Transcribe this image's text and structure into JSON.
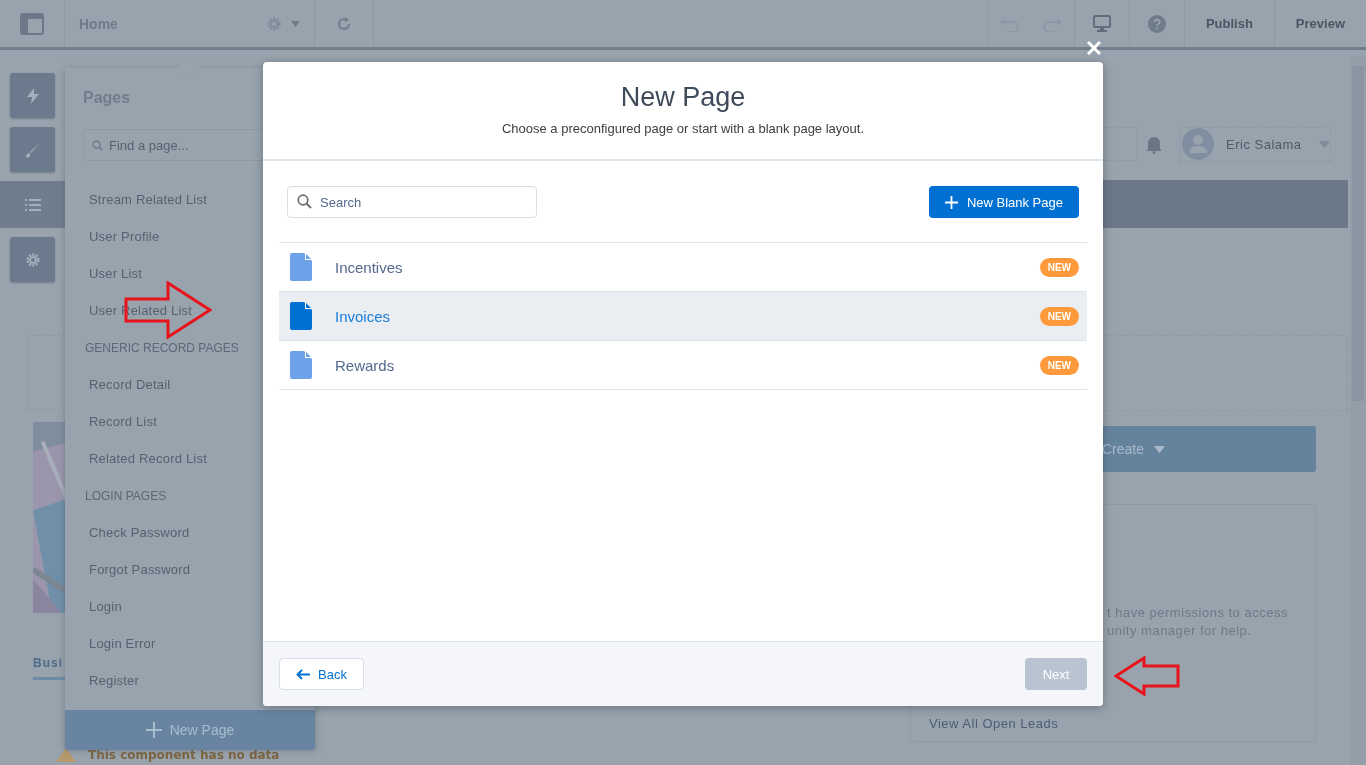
{
  "top_bar": {
    "page_name": "Home",
    "buttons": [
      {
        "label": "Publish"
      },
      {
        "label": "Preview"
      }
    ]
  },
  "left_rail": {
    "items": [
      {
        "kind": "bolt",
        "selected": false
      },
      {
        "kind": "brush",
        "selected": false
      },
      {
        "kind": "list",
        "selected": true
      },
      {
        "kind": "gear",
        "selected": false
      }
    ]
  },
  "pages_panel": {
    "title": "Pages",
    "search": {
      "placeholder": "Find a page..."
    },
    "items": [
      {
        "kind": "item",
        "label": "Stream Related List"
      },
      {
        "kind": "item",
        "label": "User Profile"
      },
      {
        "kind": "item",
        "label": "User List"
      },
      {
        "kind": "item",
        "label": "User Related List"
      },
      {
        "kind": "header",
        "label": "GENERIC RECORD PAGES"
      },
      {
        "kind": "item",
        "label": "Record Detail"
      },
      {
        "kind": "item",
        "label": "Record List"
      },
      {
        "kind": "item",
        "label": "Related Record List"
      },
      {
        "kind": "header",
        "label": "LOGIN PAGES"
      },
      {
        "kind": "item",
        "label": "Check Password"
      },
      {
        "kind": "item",
        "label": "Forgot Password"
      },
      {
        "kind": "item",
        "label": "Login"
      },
      {
        "kind": "item",
        "label": "Login Error"
      },
      {
        "kind": "item",
        "label": "Register"
      }
    ],
    "new_page_button": "New Page"
  },
  "canvas": {
    "tab": "Busi",
    "notice": "This component has no data",
    "user": {
      "name": "Eric Salama"
    },
    "create_button": "Create",
    "card": {
      "message_lines": [
        "t have permissions to access",
        "unity manager for help."
      ],
      "link": "View All Open Leads"
    }
  },
  "modal": {
    "title": "New Page",
    "subtitle": "Choose a preconfigured page or start with a blank page layout.",
    "search": {
      "placeholder": "Search"
    },
    "new_blank_button": "New Blank Page",
    "templates": [
      {
        "name": "Incentives",
        "badge": "NEW",
        "selected": false
      },
      {
        "name": "Invoices",
        "badge": "NEW",
        "selected": true
      },
      {
        "name": "Rewards",
        "badge": "NEW",
        "selected": false
      }
    ],
    "back_button": "Back",
    "next_button": {
      "label": "Next",
      "disabled": true
    }
  }
}
